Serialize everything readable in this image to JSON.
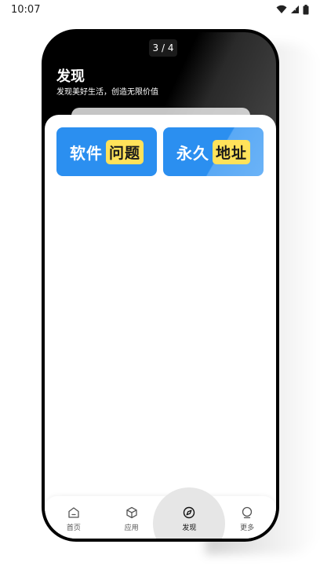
{
  "status_bar": {
    "time": "10:07",
    "icons": [
      "wifi-icon",
      "signal-icon",
      "battery-icon"
    ]
  },
  "pager": {
    "text": "3 / 4"
  },
  "header": {
    "title": "发现",
    "subtitle": "发现美好生活，创造无限价值"
  },
  "tiles": [
    {
      "white_text": "软件",
      "badge_text": "问题"
    },
    {
      "white_text": "永久",
      "badge_text": "地址"
    }
  ],
  "nav": {
    "items": [
      {
        "label": "首页",
        "icon": "home-icon",
        "active": false
      },
      {
        "label": "应用",
        "icon": "cube-icon",
        "active": false
      },
      {
        "label": "发现",
        "icon": "compass-icon",
        "active": true
      },
      {
        "label": "更多",
        "icon": "more-icon",
        "active": false
      }
    ]
  },
  "colors": {
    "tile_blue": "#2b8ff0",
    "badge_yellow": "#ffe25a",
    "phone_frame": "#000000"
  }
}
